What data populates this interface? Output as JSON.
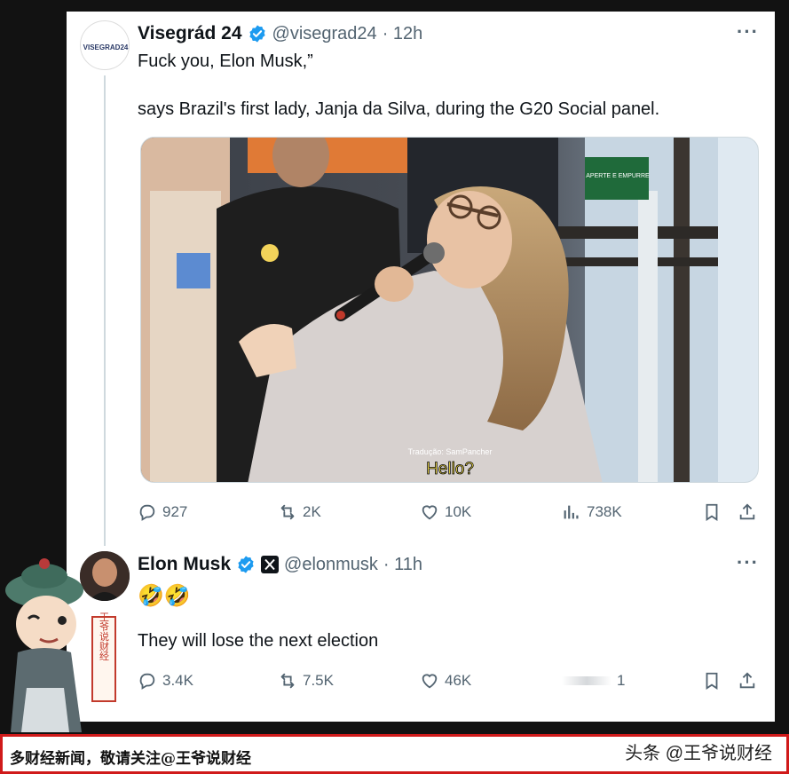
{
  "tweet1": {
    "avatar_text": "VISEGRAD24",
    "display_name": "Visegrád 24",
    "handle": "@visegrad24",
    "time": "· 12h",
    "line1": "Fuck you, Elon Musk,”",
    "line2": "says Brazil's first lady, Janja da Silva, during the G20 Social panel.",
    "media": {
      "sign_text": "APERTE E EMPURRE",
      "subtitle_credit": "Tradução: SamPancher",
      "subtitle": "Hello?"
    },
    "actions": {
      "replies": "927",
      "reposts": "2K",
      "likes": "10K",
      "views": "738K"
    }
  },
  "tweet2": {
    "display_name": "Elon Musk",
    "handle": "@elonmusk",
    "time": "· 11h",
    "emoji": "🤣🤣",
    "text": "They will lose the next election",
    "actions": {
      "replies": "3.4K",
      "reposts": "7.5K",
      "likes": "46K",
      "views": "1"
    }
  },
  "mascot": {
    "banner_text": "王爷说财经"
  },
  "bottom_bar": {
    "left_text": "多财经新闻，敬请关注@王爷说财经",
    "right_text": "头条 @王爷说财经"
  },
  "colors": {
    "verified": "#1d9bf0",
    "border_red": "#d01a1a",
    "muted": "#536471"
  }
}
